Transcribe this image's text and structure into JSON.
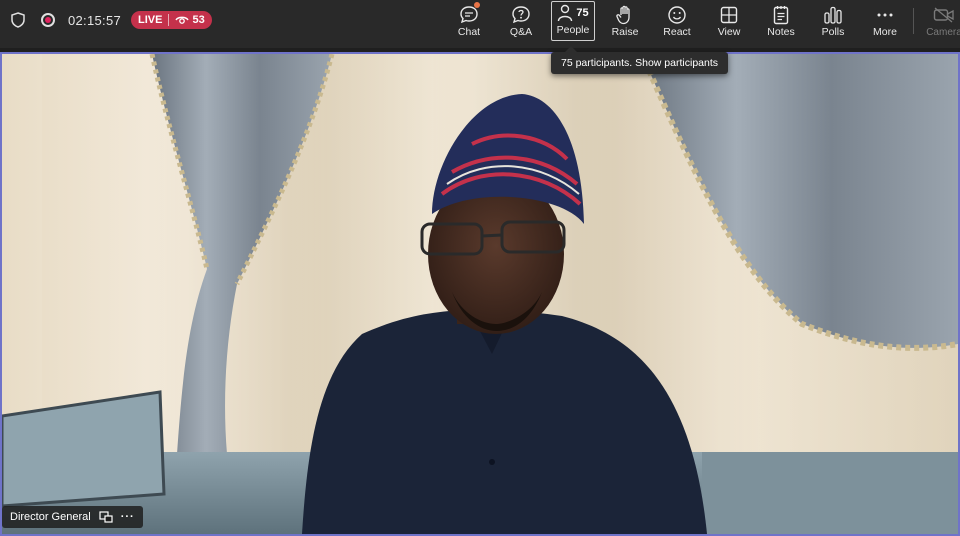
{
  "topbar": {
    "timer": "02:15:57",
    "live_label": "LIVE",
    "viewers": "53",
    "icons": {
      "shield": "shield-icon",
      "record": "record-icon",
      "eye": "eye-icon"
    }
  },
  "actions": [
    {
      "id": "chat",
      "label": "Chat",
      "icon": "chat-icon"
    },
    {
      "id": "qa",
      "label": "Q&A",
      "icon": "question-icon"
    },
    {
      "id": "people",
      "label": "People",
      "count": "75",
      "icon": "people-icon"
    },
    {
      "id": "raise",
      "label": "Raise",
      "icon": "hand-icon"
    },
    {
      "id": "react",
      "label": "React",
      "icon": "smiley-icon"
    },
    {
      "id": "view",
      "label": "View",
      "icon": "grid-icon"
    },
    {
      "id": "notes",
      "label": "Notes",
      "icon": "notes-icon"
    },
    {
      "id": "polls",
      "label": "Polls",
      "icon": "polls-icon"
    },
    {
      "id": "more",
      "label": "More",
      "icon": "ellipsis-icon"
    }
  ],
  "camera": {
    "label": "Camera",
    "icon": "camera-icon"
  },
  "tooltip": {
    "text": "75 participants. Show participants"
  },
  "video": {
    "participant_name": "Director General",
    "colors": {
      "stage_border": "#6f73c9",
      "live": "#c4314b"
    }
  }
}
